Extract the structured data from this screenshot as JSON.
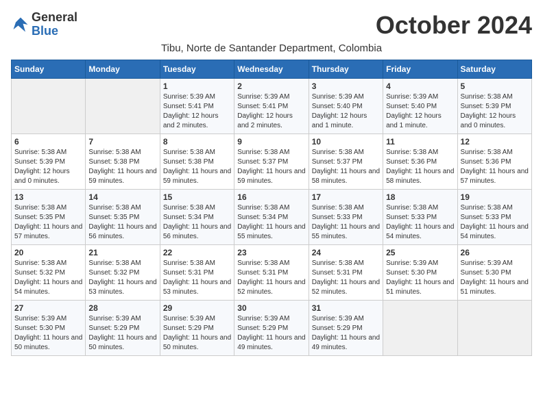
{
  "header": {
    "logo_general": "General",
    "logo_blue": "Blue",
    "month_title": "October 2024",
    "location": "Tibu, Norte de Santander Department, Colombia"
  },
  "days_of_week": [
    "Sunday",
    "Monday",
    "Tuesday",
    "Wednesday",
    "Thursday",
    "Friday",
    "Saturday"
  ],
  "weeks": [
    [
      {
        "day": "",
        "sunrise": "",
        "sunset": "",
        "daylight": ""
      },
      {
        "day": "",
        "sunrise": "",
        "sunset": "",
        "daylight": ""
      },
      {
        "day": "1",
        "sunrise": "Sunrise: 5:39 AM",
        "sunset": "Sunset: 5:41 PM",
        "daylight": "Daylight: 12 hours and 2 minutes."
      },
      {
        "day": "2",
        "sunrise": "Sunrise: 5:39 AM",
        "sunset": "Sunset: 5:41 PM",
        "daylight": "Daylight: 12 hours and 2 minutes."
      },
      {
        "day": "3",
        "sunrise": "Sunrise: 5:39 AM",
        "sunset": "Sunset: 5:40 PM",
        "daylight": "Daylight: 12 hours and 1 minute."
      },
      {
        "day": "4",
        "sunrise": "Sunrise: 5:39 AM",
        "sunset": "Sunset: 5:40 PM",
        "daylight": "Daylight: 12 hours and 1 minute."
      },
      {
        "day": "5",
        "sunrise": "Sunrise: 5:38 AM",
        "sunset": "Sunset: 5:39 PM",
        "daylight": "Daylight: 12 hours and 0 minutes."
      }
    ],
    [
      {
        "day": "6",
        "sunrise": "Sunrise: 5:38 AM",
        "sunset": "Sunset: 5:39 PM",
        "daylight": "Daylight: 12 hours and 0 minutes."
      },
      {
        "day": "7",
        "sunrise": "Sunrise: 5:38 AM",
        "sunset": "Sunset: 5:38 PM",
        "daylight": "Daylight: 11 hours and 59 minutes."
      },
      {
        "day": "8",
        "sunrise": "Sunrise: 5:38 AM",
        "sunset": "Sunset: 5:38 PM",
        "daylight": "Daylight: 11 hours and 59 minutes."
      },
      {
        "day": "9",
        "sunrise": "Sunrise: 5:38 AM",
        "sunset": "Sunset: 5:37 PM",
        "daylight": "Daylight: 11 hours and 59 minutes."
      },
      {
        "day": "10",
        "sunrise": "Sunrise: 5:38 AM",
        "sunset": "Sunset: 5:37 PM",
        "daylight": "Daylight: 11 hours and 58 minutes."
      },
      {
        "day": "11",
        "sunrise": "Sunrise: 5:38 AM",
        "sunset": "Sunset: 5:36 PM",
        "daylight": "Daylight: 11 hours and 58 minutes."
      },
      {
        "day": "12",
        "sunrise": "Sunrise: 5:38 AM",
        "sunset": "Sunset: 5:36 PM",
        "daylight": "Daylight: 11 hours and 57 minutes."
      }
    ],
    [
      {
        "day": "13",
        "sunrise": "Sunrise: 5:38 AM",
        "sunset": "Sunset: 5:35 PM",
        "daylight": "Daylight: 11 hours and 57 minutes."
      },
      {
        "day": "14",
        "sunrise": "Sunrise: 5:38 AM",
        "sunset": "Sunset: 5:35 PM",
        "daylight": "Daylight: 11 hours and 56 minutes."
      },
      {
        "day": "15",
        "sunrise": "Sunrise: 5:38 AM",
        "sunset": "Sunset: 5:34 PM",
        "daylight": "Daylight: 11 hours and 56 minutes."
      },
      {
        "day": "16",
        "sunrise": "Sunrise: 5:38 AM",
        "sunset": "Sunset: 5:34 PM",
        "daylight": "Daylight: 11 hours and 55 minutes."
      },
      {
        "day": "17",
        "sunrise": "Sunrise: 5:38 AM",
        "sunset": "Sunset: 5:33 PM",
        "daylight": "Daylight: 11 hours and 55 minutes."
      },
      {
        "day": "18",
        "sunrise": "Sunrise: 5:38 AM",
        "sunset": "Sunset: 5:33 PM",
        "daylight": "Daylight: 11 hours and 54 minutes."
      },
      {
        "day": "19",
        "sunrise": "Sunrise: 5:38 AM",
        "sunset": "Sunset: 5:33 PM",
        "daylight": "Daylight: 11 hours and 54 minutes."
      }
    ],
    [
      {
        "day": "20",
        "sunrise": "Sunrise: 5:38 AM",
        "sunset": "Sunset: 5:32 PM",
        "daylight": "Daylight: 11 hours and 54 minutes."
      },
      {
        "day": "21",
        "sunrise": "Sunrise: 5:38 AM",
        "sunset": "Sunset: 5:32 PM",
        "daylight": "Daylight: 11 hours and 53 minutes."
      },
      {
        "day": "22",
        "sunrise": "Sunrise: 5:38 AM",
        "sunset": "Sunset: 5:31 PM",
        "daylight": "Daylight: 11 hours and 53 minutes."
      },
      {
        "day": "23",
        "sunrise": "Sunrise: 5:38 AM",
        "sunset": "Sunset: 5:31 PM",
        "daylight": "Daylight: 11 hours and 52 minutes."
      },
      {
        "day": "24",
        "sunrise": "Sunrise: 5:38 AM",
        "sunset": "Sunset: 5:31 PM",
        "daylight": "Daylight: 11 hours and 52 minutes."
      },
      {
        "day": "25",
        "sunrise": "Sunrise: 5:39 AM",
        "sunset": "Sunset: 5:30 PM",
        "daylight": "Daylight: 11 hours and 51 minutes."
      },
      {
        "day": "26",
        "sunrise": "Sunrise: 5:39 AM",
        "sunset": "Sunset: 5:30 PM",
        "daylight": "Daylight: 11 hours and 51 minutes."
      }
    ],
    [
      {
        "day": "27",
        "sunrise": "Sunrise: 5:39 AM",
        "sunset": "Sunset: 5:30 PM",
        "daylight": "Daylight: 11 hours and 50 minutes."
      },
      {
        "day": "28",
        "sunrise": "Sunrise: 5:39 AM",
        "sunset": "Sunset: 5:29 PM",
        "daylight": "Daylight: 11 hours and 50 minutes."
      },
      {
        "day": "29",
        "sunrise": "Sunrise: 5:39 AM",
        "sunset": "Sunset: 5:29 PM",
        "daylight": "Daylight: 11 hours and 50 minutes."
      },
      {
        "day": "30",
        "sunrise": "Sunrise: 5:39 AM",
        "sunset": "Sunset: 5:29 PM",
        "daylight": "Daylight: 11 hours and 49 minutes."
      },
      {
        "day": "31",
        "sunrise": "Sunrise: 5:39 AM",
        "sunset": "Sunset: 5:29 PM",
        "daylight": "Daylight: 11 hours and 49 minutes."
      },
      {
        "day": "",
        "sunrise": "",
        "sunset": "",
        "daylight": ""
      },
      {
        "day": "",
        "sunrise": "",
        "sunset": "",
        "daylight": ""
      }
    ]
  ]
}
